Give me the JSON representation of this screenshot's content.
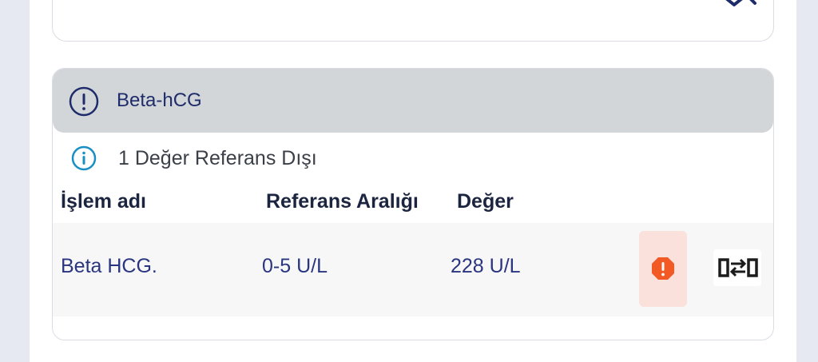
{
  "panel": {
    "title": "Beta-hCG",
    "header_icon": "exclamation-circle-icon",
    "notice_icon": "info-circle-icon",
    "notice_text": "1 Değer Referans Dışı"
  },
  "table": {
    "columns": [
      "İşlem adı",
      "Referans Aralığı",
      "Değer"
    ],
    "rows": [
      {
        "name": "Beta HCG.",
        "reference": "0-5 U/L",
        "value": "228 U/L"
      }
    ]
  },
  "actions": {
    "alert_icon": "warning-octagon-icon",
    "compare_icon": "compare-arrows-icon"
  },
  "colors": {
    "accent_navy": "#1f2c6b",
    "alert_orange": "#f15a24",
    "alert_bg": "#fbe1dc",
    "info_blue": "#1a8fc4",
    "header_gray": "#d3d6d8"
  }
}
